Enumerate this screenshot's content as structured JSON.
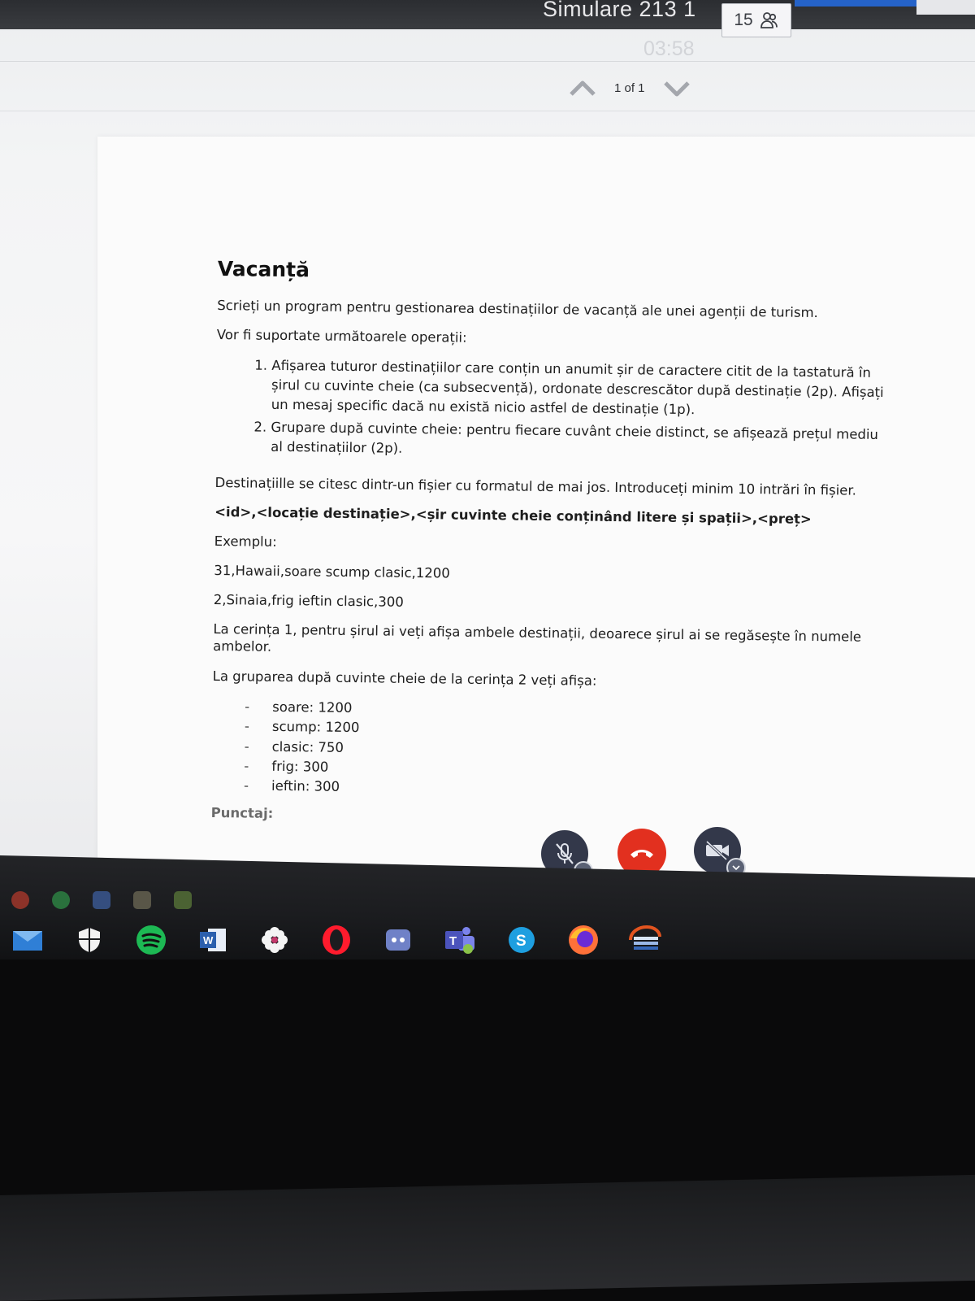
{
  "meeting": {
    "title": "Simulare 213 1",
    "participants_count": "15",
    "timer": "03:58"
  },
  "viewer": {
    "page_indicator": "1 of 1"
  },
  "document": {
    "heading": "Vacanță",
    "intro": "Scrieți un program pentru gestionarea destinațiilor de vacanță ale unei agenții de turism.",
    "ops_intro": "Vor fi suportate următoarele operații:",
    "operations": [
      "Afișarea tuturor destinațiilor care conțin un anumit șir de caractere citit de la tastatură în șirul cu cuvinte cheie (ca subsecvență), ordonate descrescător după destinație (2p). Afișați un mesaj specific dacă nu există nicio astfel de destinație (1p).",
      "Grupare după cuvinte cheie: pentru fiecare cuvânt cheie distinct, se afișează prețul mediu al destinațiilor (2p)."
    ],
    "file_note": "Destinațiille se citesc dintr-un fișier cu formatul de mai jos. Introduceți minim 10 intrări în fișier.",
    "format_line": "<id>,<locație destinație>,<șir cuvinte cheie conținând litere și spații>,<preț>",
    "example_label": "Exemplu:",
    "example_lines": [
      "31,Hawaii,soare scump clasic,1200",
      "2,Sinaia,frig ieftin clasic,300"
    ],
    "req1_note": "La cerința 1, pentru șirul ai veți afișa ambele destinații, deoarece șirul ai se regăsește în numele ambelor.",
    "req2_note": "La gruparea după cuvinte cheie de la cerința 2 veți afișa:",
    "grouping": [
      "soare: 1200",
      "scump: 1200",
      "clasic: 750",
      "frig: 300",
      "ieftin: 300"
    ],
    "footer_label": "Punctaj:"
  },
  "call_controls": {
    "mic": "mic-off-icon",
    "end": "hang-up-icon",
    "camera": "camera-off-icon"
  },
  "taskbar": {
    "tray_icons": [
      "record-icon",
      "green-dot-icon",
      "people-icon",
      "archive-icon",
      "notepad-icon"
    ],
    "apps": [
      {
        "icon": "mail-icon"
      },
      {
        "icon": "shield-icon"
      },
      {
        "icon": "spotify-icon"
      },
      {
        "icon": "word-icon"
      },
      {
        "icon": "flower-icon"
      },
      {
        "icon": "opera-icon"
      },
      {
        "icon": "discord-icon"
      },
      {
        "icon": "teams-icon"
      },
      {
        "icon": "skype-icon"
      },
      {
        "icon": "firefox-icon"
      },
      {
        "icon": "codeblocks-icon"
      }
    ]
  },
  "colors": {
    "end_call": "#e2301f",
    "call_button": "#33384a",
    "running_indicator": "#5fb6c8",
    "accent_blue": "#2563c9"
  }
}
